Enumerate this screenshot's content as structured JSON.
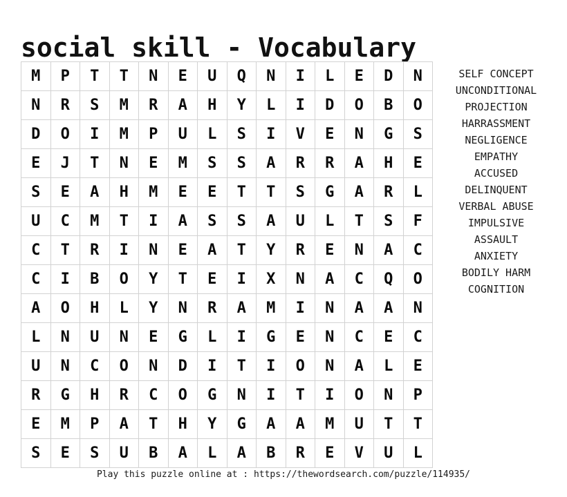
{
  "title": "social skill - Vocabulary",
  "footer": {
    "text": "Play this puzzle online at : https://thewordsearch.com/puzzle/114935/"
  },
  "grid": {
    "rows": 14,
    "cols": 14,
    "letters": [
      [
        "M",
        "P",
        "T",
        "T",
        "N",
        "E",
        "U",
        "Q",
        "N",
        "I",
        "L",
        "E",
        "D",
        "N"
      ],
      [
        "N",
        "R",
        "S",
        "M",
        "R",
        "A",
        "H",
        "Y",
        "L",
        "I",
        "D",
        "O",
        "B",
        "O"
      ],
      [
        "D",
        "O",
        "I",
        "M",
        "P",
        "U",
        "L",
        "S",
        "I",
        "V",
        "E",
        "N",
        "G",
        "S"
      ],
      [
        "E",
        "J",
        "T",
        "N",
        "E",
        "M",
        "S",
        "S",
        "A",
        "R",
        "R",
        "A",
        "H",
        "E"
      ],
      [
        "S",
        "E",
        "A",
        "H",
        "M",
        "E",
        "E",
        "T",
        "T",
        "S",
        "G",
        "A",
        "R",
        "L"
      ],
      [
        "U",
        "C",
        "M",
        "T",
        "I",
        "A",
        "S",
        "S",
        "A",
        "U",
        "L",
        "T",
        "S",
        "F"
      ],
      [
        "C",
        "T",
        "R",
        "I",
        "N",
        "E",
        "A",
        "T",
        "Y",
        "R",
        "E",
        "N",
        "A",
        "C"
      ],
      [
        "C",
        "I",
        "B",
        "O",
        "Y",
        "T",
        "E",
        "I",
        "X",
        "N",
        "A",
        "C",
        "Q",
        "O"
      ],
      [
        "A",
        "O",
        "H",
        "L",
        "Y",
        "N",
        "R",
        "A",
        "M",
        "I",
        "N",
        "A",
        "A",
        "N"
      ],
      [
        "L",
        "N",
        "U",
        "N",
        "E",
        "G",
        "L",
        "I",
        "G",
        "E",
        "N",
        "C",
        "E",
        "C"
      ],
      [
        "U",
        "N",
        "C",
        "O",
        "N",
        "D",
        "I",
        "T",
        "I",
        "O",
        "N",
        "A",
        "L",
        "E"
      ],
      [
        "R",
        "G",
        "H",
        "R",
        "C",
        "O",
        "G",
        "N",
        "I",
        "T",
        "I",
        "O",
        "N",
        "P"
      ],
      [
        "E",
        "M",
        "P",
        "A",
        "T",
        "H",
        "Y",
        "G",
        "A",
        "A",
        "M",
        "U",
        "T",
        "T"
      ],
      [
        "S",
        "E",
        "S",
        "U",
        "B",
        "A",
        "L",
        "A",
        "B",
        "R",
        "E",
        "V",
        "U",
        "L"
      ]
    ]
  },
  "word_list": {
    "words": [
      "SELF CONCEPT",
      "UNCONDITIONAL",
      "PROJECTION",
      "HARRASSMENT",
      "NEGLIGENCE",
      "EMPATHY",
      "ACCUSED",
      "DELINQUENT",
      "VERBAL ABUSE",
      "IMPULSIVE",
      "ASSAULT",
      "ANXIETY",
      "BODILY HARM",
      "COGNITION"
    ]
  },
  "colors": {
    "background": "#ffffff",
    "text": "#000000",
    "grid_border": "#d2d2d2"
  }
}
